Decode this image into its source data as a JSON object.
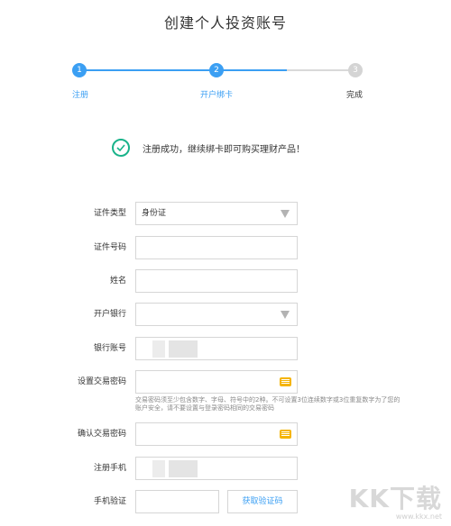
{
  "page": {
    "title": "创建个人投资账号"
  },
  "steps": [
    {
      "number": "1",
      "label": "注册"
    },
    {
      "number": "2",
      "label": "开户绑卡"
    },
    {
      "number": "3",
      "label": "完成"
    }
  ],
  "success": {
    "message": "注册成功，继续绑卡即可购买理财产品！"
  },
  "form": {
    "id_type": {
      "label": "证件类型",
      "value": "身份证"
    },
    "id_number": {
      "label": "证件号码",
      "value": ""
    },
    "name": {
      "label": "姓名",
      "value": ""
    },
    "bank": {
      "label": "开户银行",
      "value": ""
    },
    "bank_account": {
      "label": "银行账号",
      "value": ""
    },
    "trade_password": {
      "label": "设置交易密码",
      "value": ""
    },
    "password_hint": "交易密码须至少包含数字、字母、符号中的2种。不可设置3位连续数字或3位重复数字为了您的账户安全，请不要设置与登录密码相同的交易密码",
    "confirm_password": {
      "label": "确认交易密码",
      "value": ""
    },
    "phone": {
      "label": "注册手机",
      "value": ""
    },
    "sms_code": {
      "label": "手机验证",
      "value": "",
      "button_label": "获取验证码"
    }
  },
  "watermark": {
    "brand": "KK下载",
    "url": "www.kkx.net"
  }
}
